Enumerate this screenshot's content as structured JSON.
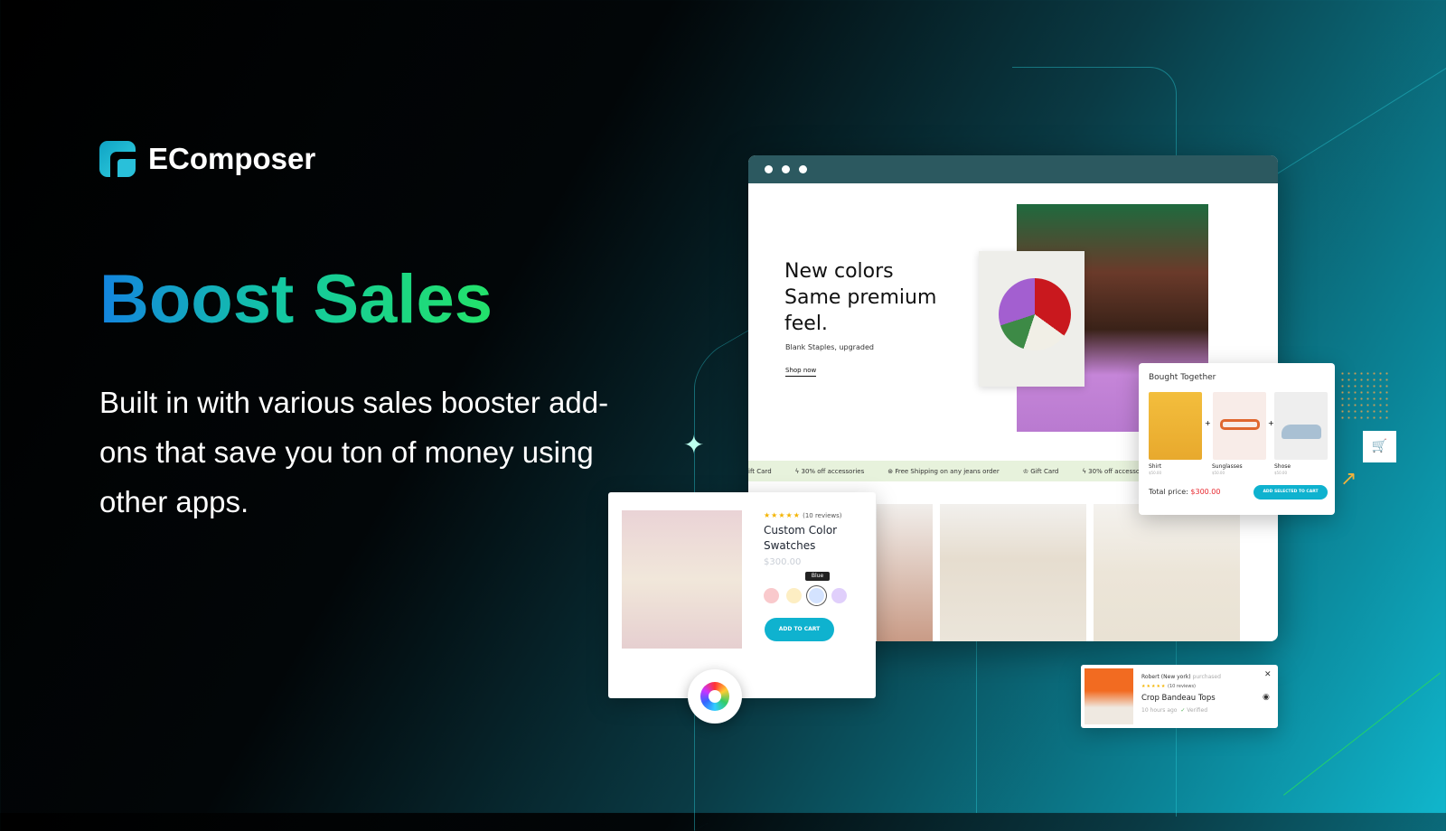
{
  "brand": {
    "name": "EComposer"
  },
  "headline": "Boost Sales",
  "description": "Built in with various sales booster add-ons that save you ton of money using other apps.",
  "store": {
    "hero_title_1": "New colors",
    "hero_title_2": "Same premium",
    "hero_title_3": "feel.",
    "hero_subtitle": "Blank Staples, upgraded",
    "hero_link": "Shop now",
    "announcements": [
      "ift Card",
      "30% off accessories",
      "Free Shipping on any jeans order",
      "Gift Card",
      "30% off accessorie"
    ]
  },
  "bought_together": {
    "title": "Bought Together",
    "items": [
      {
        "name": "Shirt",
        "price": "$50.00"
      },
      {
        "name": "Sunglasses",
        "price": "$50.00"
      },
      {
        "name": "Shose",
        "price": "$50.00"
      }
    ],
    "total_label": "Total price:",
    "total": "$300.00",
    "button": "ADD SELECTED TO CART"
  },
  "swatch_card": {
    "stars": "★★★★★",
    "reviews": "(10 reviews)",
    "title_1": "Custom Color",
    "title_2": "Swatches",
    "price": "$300.00",
    "tooltip": "Blue",
    "swatches": [
      "#f9c9cc",
      "#fdeec3",
      "#d4e3ff",
      "#e0cffb"
    ],
    "button": "ADD TO CART"
  },
  "notification": {
    "buyer": "Robert (New york)",
    "action": "purchased",
    "stars": "★★★★★",
    "reviews": "(10 reviews)",
    "product": "Crop Bandeau Tops",
    "time": "10 hours ago",
    "verified": "Verified"
  },
  "colors": {
    "accent": "#0fb2cf",
    "price_red": "#e8282f"
  }
}
